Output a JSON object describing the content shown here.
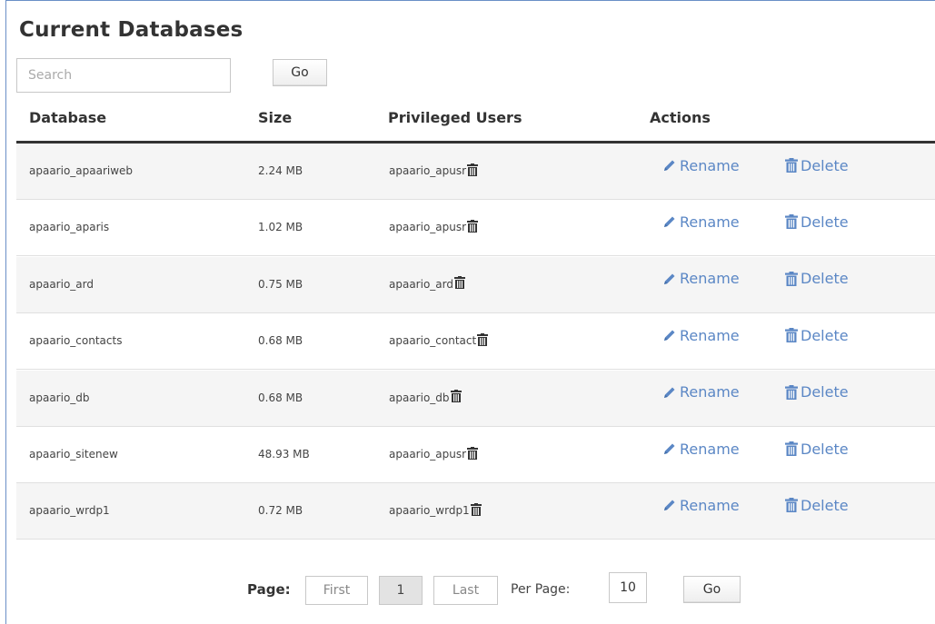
{
  "title": "Current Databases",
  "search": {
    "placeholder": "Search",
    "go_label": "Go"
  },
  "columns": {
    "database": "Database",
    "size": "Size",
    "users": "Privileged Users",
    "actions": "Actions"
  },
  "actions": {
    "rename": "Rename",
    "delete": "Delete"
  },
  "rows": [
    {
      "database": "apaario_apaariweb",
      "size": "2.24 MB",
      "user": "apaario_apusr"
    },
    {
      "database": "apaario_aparis",
      "size": "1.02 MB",
      "user": "apaario_apusr"
    },
    {
      "database": "apaario_ard",
      "size": "0.75 MB",
      "user": "apaario_ard"
    },
    {
      "database": "apaario_contacts",
      "size": "0.68 MB",
      "user": "apaario_contact"
    },
    {
      "database": "apaario_db",
      "size": "0.68 MB",
      "user": "apaario_db"
    },
    {
      "database": "apaario_sitenew",
      "size": "48.93 MB",
      "user": "apaario_apusr"
    },
    {
      "database": "apaario_wrdp1",
      "size": "0.72 MB",
      "user": "apaario_wrdp1"
    }
  ],
  "pagination": {
    "page_label": "Page:",
    "first_label": "First",
    "current_page": "1",
    "last_label": "Last",
    "per_page_label": "Per Page:",
    "per_page_value": "10",
    "go_label": "Go"
  },
  "colors": {
    "link": "#5b87c5",
    "header_rule": "#333333",
    "frame_border": "#6a8fc7"
  },
  "icons": {
    "rename": "pencil-icon",
    "delete": "trash-icon"
  }
}
